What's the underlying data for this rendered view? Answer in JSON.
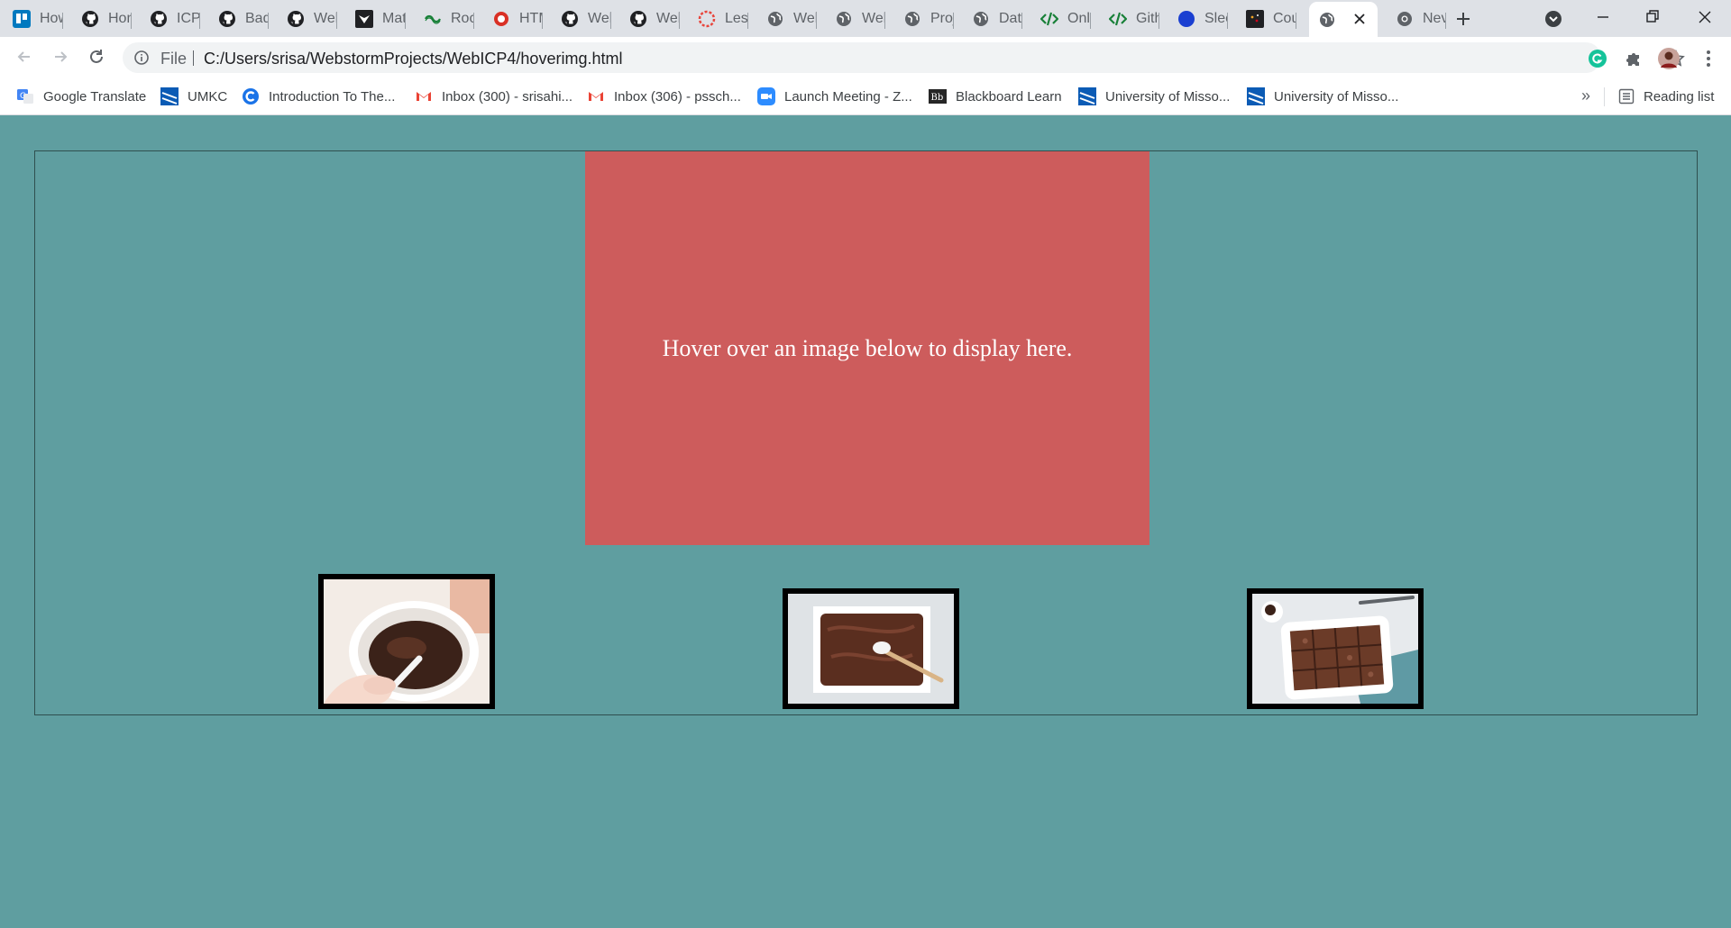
{
  "browser": {
    "tabs": [
      {
        "title": "How",
        "icon": "trello-icon",
        "color": "#0079bf"
      },
      {
        "title": "Hom",
        "icon": "github-icon",
        "color": "#202124"
      },
      {
        "title": "ICP:",
        "icon": "github-icon",
        "color": "#202124"
      },
      {
        "title": "Bad",
        "icon": "github-icon",
        "color": "#202124"
      },
      {
        "title": "Wel",
        "icon": "github-icon",
        "color": "#202124"
      },
      {
        "title": "Mat",
        "icon": "mathway-icon",
        "color": "#202124"
      },
      {
        "title": "Roc",
        "icon": "rocket-icon",
        "color": "#188038"
      },
      {
        "title": "HTM",
        "icon": "html-icon",
        "color": "#d93025"
      },
      {
        "title": "Wel",
        "icon": "github-icon",
        "color": "#202124"
      },
      {
        "title": "Wel",
        "icon": "github-icon",
        "color": "#202124"
      },
      {
        "title": "Less",
        "icon": "lesson-icon",
        "color": "#e8453c"
      },
      {
        "title": "Wel",
        "icon": "globe-icon",
        "color": "#5f6368"
      },
      {
        "title": "Wel",
        "icon": "globe-icon",
        "color": "#5f6368"
      },
      {
        "title": "Proj",
        "icon": "globe-icon",
        "color": "#5f6368"
      },
      {
        "title": "Dat",
        "icon": "globe-icon",
        "color": "#5f6368"
      },
      {
        "title": "Onl",
        "icon": "code-icon",
        "color": "#188038"
      },
      {
        "title": "Gith",
        "icon": "code-icon",
        "color": "#188038"
      },
      {
        "title": "Slee",
        "icon": "circle-icon",
        "color": "#1a3fd1"
      },
      {
        "title": "Cou",
        "icon": "coursera-icon",
        "color": "#202124"
      },
      {
        "title": "",
        "icon": "globe-icon",
        "color": "#5f6368",
        "active": true
      },
      {
        "title": "Nev",
        "icon": "chrome-icon",
        "color": "#5f6368"
      }
    ],
    "address": {
      "scheme": "File",
      "url": "C:/Users/srisa/WebstormProjects/WebICP4/hoverimg.html"
    },
    "bookmarks": [
      {
        "label": "Google Translate",
        "icon": "translate-icon"
      },
      {
        "label": "UMKC",
        "icon": "umkc-icon"
      },
      {
        "label": "Introduction To The...",
        "icon": "c-icon"
      },
      {
        "label": "Inbox (300) - srisahi...",
        "icon": "gmail-icon"
      },
      {
        "label": "Inbox (306) - pssch...",
        "icon": "gmail-icon"
      },
      {
        "label": "Launch Meeting - Z...",
        "icon": "zoom-icon"
      },
      {
        "label": "Blackboard Learn",
        "icon": "blackboard-icon"
      },
      {
        "label": "University of Misso...",
        "icon": "umkc-icon"
      },
      {
        "label": "University of Misso...",
        "icon": "umkc-icon"
      }
    ],
    "overflow_label": "»",
    "reading_list": "Reading list"
  },
  "page": {
    "display_text": "Hover over an image below to display here.",
    "background": "#5f9ea0",
    "display_color": "#cd5c5c",
    "thumbnails": [
      {
        "name": "batter-mixing-bowl"
      },
      {
        "name": "batter-in-pan"
      },
      {
        "name": "baked-brownies"
      }
    ]
  }
}
